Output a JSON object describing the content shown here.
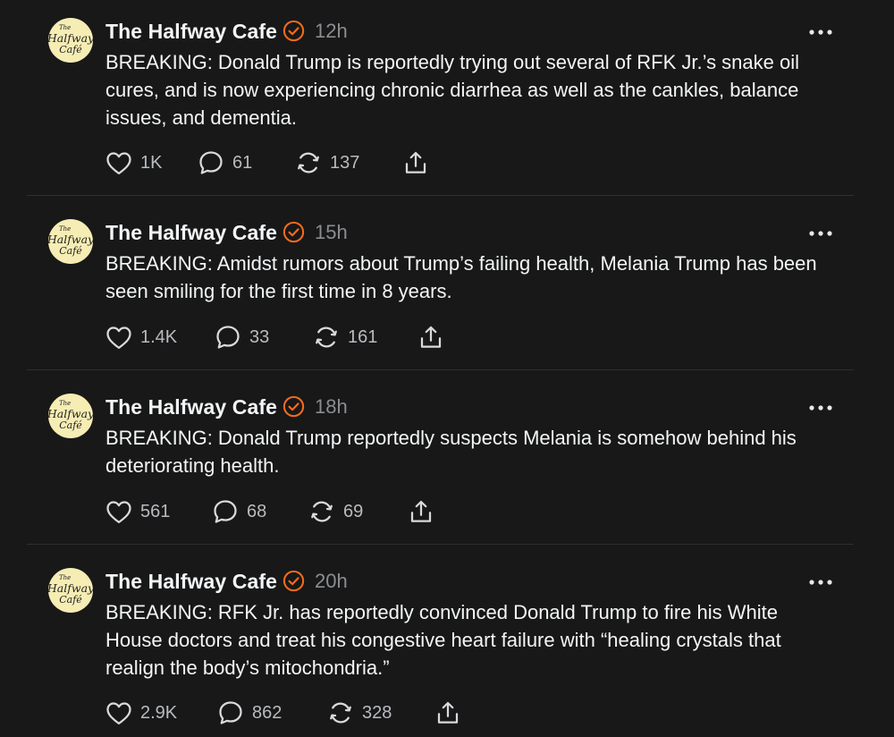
{
  "posts": [
    {
      "author": "The Halfway Cafe",
      "time": "12h",
      "text": "BREAKING: Donald Trump is reportedly trying out several of RFK Jr.’s snake oil cures, and is now experiencing chronic diarrhea as well as the cankles, balance issues, and dementia.",
      "likes": "1K",
      "replies": "61",
      "reposts": "137"
    },
    {
      "author": "The Halfway Cafe",
      "time": "15h",
      "text": "BREAKING: Amidst rumors about Trump’s failing health, Melania Trump has been seen smiling for the first time in 8 years.",
      "likes": "1.4K",
      "replies": "33",
      "reposts": "161"
    },
    {
      "author": "The Halfway Cafe",
      "time": "18h",
      "text": "BREAKING: Donald Trump reportedly suspects Melania is somehow behind his deteriorating health.",
      "likes": "561",
      "replies": "68",
      "reposts": "69"
    },
    {
      "author": "The Halfway Cafe",
      "time": "20h",
      "text": "BREAKING: RFK Jr. has reportedly convinced Donald Trump to fire his White House doctors and treat his congestive heart failure with “healing crystals that realign the body’s mitochondria.”",
      "likes": "2.9K",
      "replies": "862",
      "reposts": "328"
    }
  ],
  "avatar_logo": {
    "line1": "The",
    "line2": "Halfway",
    "line3": "Café"
  },
  "icons": {
    "avatar": "halfway-cafe-logo",
    "verified": "verified-badge-icon",
    "more": "more-options-icon",
    "like": "heart-icon",
    "reply": "comment-icon",
    "repost": "repost-icon",
    "share": "share-icon"
  },
  "colors": {
    "background": "#181818",
    "text_primary": "#f3f5f7",
    "text_secondary": "#8a8d91",
    "verified_accent": "#f26b1d",
    "avatar_fill": "#f6edb4",
    "divider": "#2f2f2f"
  }
}
